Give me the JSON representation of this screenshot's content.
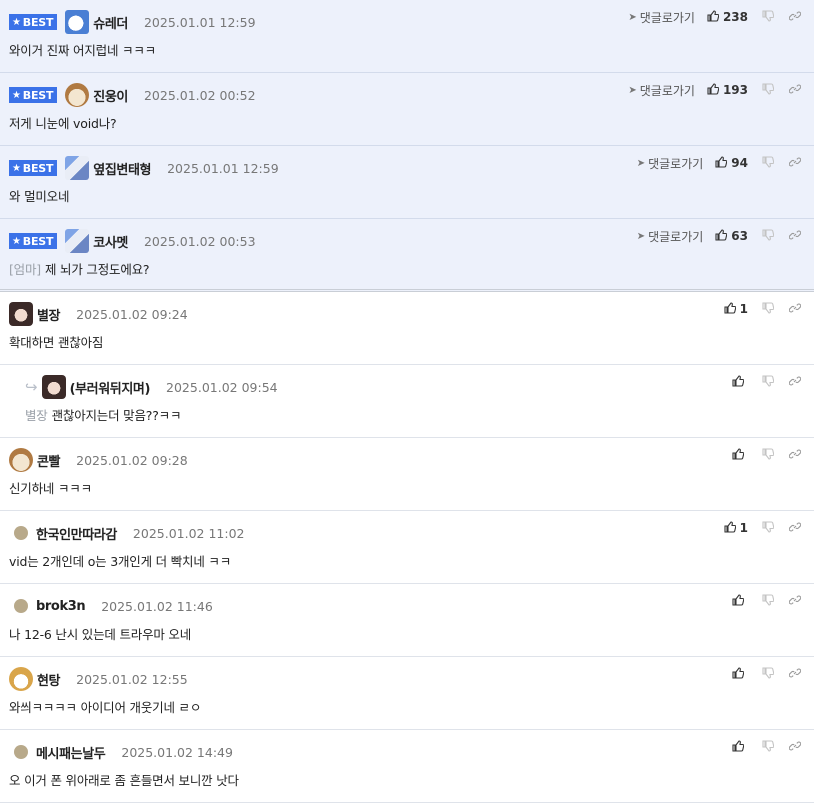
{
  "ui": {
    "go_reply_label": "댓글로가기",
    "best_label": "BEST"
  },
  "best_comments": [
    {
      "nick": "슈레더",
      "date": "2025.01.01 12:59",
      "text": "와이거 진짜 어지럽네 ㅋㅋㅋ",
      "likes": "238",
      "avatar": "bear"
    },
    {
      "nick": "진웅이",
      "date": "2025.01.02 00:52",
      "text": "저게 니눈에 void나?",
      "likes": "193",
      "avatar": "dog"
    },
    {
      "nick": "옆집변태형",
      "date": "2025.01.01 12:59",
      "text": "와 멀미오네",
      "likes": "94",
      "avatar": "pixel"
    },
    {
      "nick": "코사멧",
      "date": "2025.01.02 00:53",
      "mention": "[엄마]",
      "text": "제 뇌가 그정도에요?",
      "likes": "63",
      "avatar": "pixel"
    }
  ],
  "comments": [
    {
      "nick": "별장",
      "date": "2025.01.02 09:24",
      "text": "확대하면 괜찮아짐",
      "likes": "1",
      "avatar": "pug"
    },
    {
      "nick": "(부러워뒤지며)",
      "date": "2025.01.02 09:54",
      "mention": "별장",
      "text": "괜찮아지는더 맞음??ㅋㅋ",
      "likes": "",
      "avatar": "pug",
      "reply": true
    },
    {
      "nick": "콘빨",
      "date": "2025.01.02 09:28",
      "text": "신기하네 ㅋㅋㅋ",
      "likes": "",
      "avatar": "dog"
    },
    {
      "nick": "한국인만따라감",
      "date": "2025.01.02 11:02",
      "text": "vid는 2개인데 o는 3개인게 더 빡치네 ㅋㅋ",
      "likes": "1",
      "avatar": "circle"
    },
    {
      "nick": "brok3n",
      "date": "2025.01.02 11:46",
      "text": "나 12-6 난시 있는데 트라우마 오네",
      "likes": "",
      "avatar": "circle"
    },
    {
      "nick": "현탕",
      "date": "2025.01.02 12:55",
      "text": "와씌ㅋㅋㅋㅋ 아이디어 개웃기네 ㄹㅇ",
      "likes": "",
      "avatar": "fox"
    },
    {
      "nick": "메시패는날두",
      "date": "2025.01.02 14:49",
      "text": "오 이거 폰 위아래로 좀 흔들면서 보니깐 낫다",
      "likes": "",
      "avatar": "circle"
    }
  ]
}
